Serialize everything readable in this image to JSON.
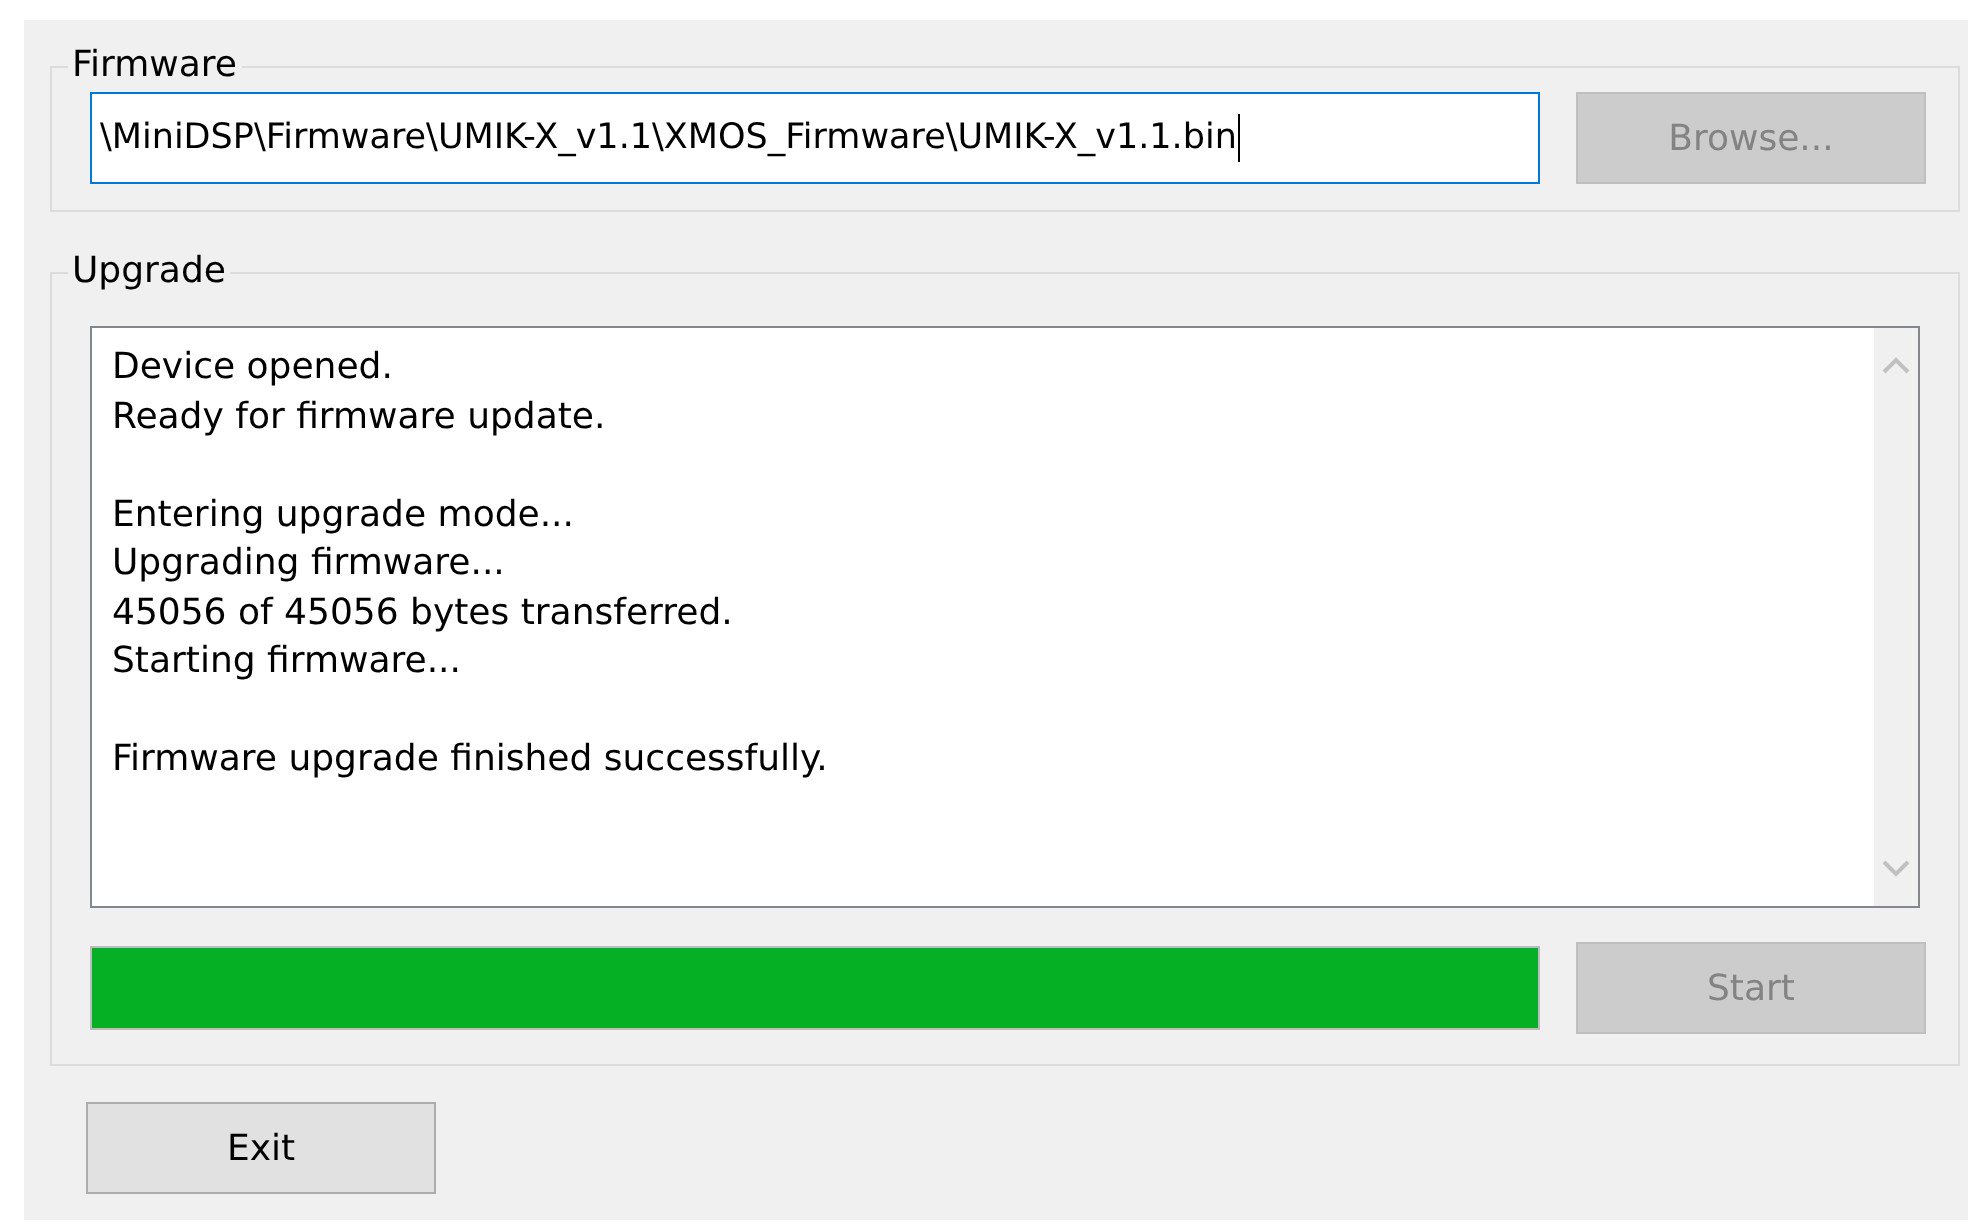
{
  "firmware": {
    "title": "Firmware",
    "path": "\\MiniDSP\\Firmware\\UMIK-X_v1.1\\XMOS_Firmware\\UMIK-X_v1.1.bin",
    "browse": {
      "label": "Browse...",
      "disabled": true
    }
  },
  "upgrade": {
    "title": "Upgrade",
    "log": [
      [
        "Device opened.",
        "Ready for firmware update."
      ],
      [
        "Entering upgrade mode...",
        "Upgrading firmware...",
        "45056 of 45056 bytes transferred.",
        "Starting firmware..."
      ],
      [
        "Firmware upgrade finished successfully."
      ]
    ],
    "progress": {
      "level": 1
    },
    "start": {
      "label": "Start",
      "disabled": true
    }
  },
  "exit": {
    "label": "Exit",
    "disabled": false
  }
}
